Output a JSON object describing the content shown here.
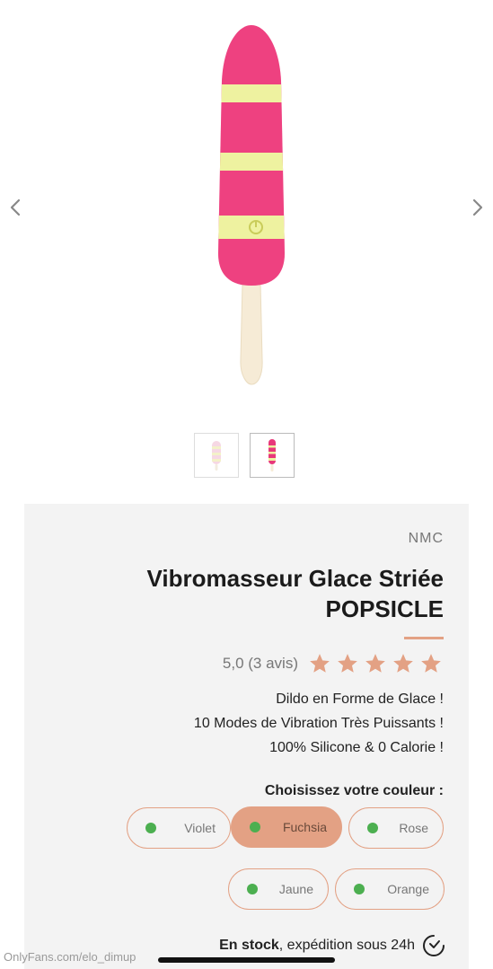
{
  "brand": "NMC",
  "product": {
    "title": "Vibromasseur Glace Striée POPSICLE",
    "rating_text": "5,0 (3 avis)",
    "stars": 5,
    "description": [
      "Dildo en Forme de Glace !",
      "10 Modes de Vibration Très Puissants !",
      "100% Silicone & 0 Calorie !"
    ]
  },
  "color_picker": {
    "label": "Choisissez votre couleur :",
    "options": [
      {
        "label": "Rose",
        "available": true,
        "selected": false
      },
      {
        "label": "Fuchsia",
        "available": true,
        "selected": true
      },
      {
        "label": "Violet",
        "available": true,
        "selected": false
      },
      {
        "label": "Orange",
        "available": true,
        "selected": false
      },
      {
        "label": "Jaune",
        "available": true,
        "selected": false
      }
    ]
  },
  "stock": {
    "status": "En stock",
    "shipping": ", expédition sous 24h"
  },
  "watermark": "OnlyFans.com/elo_dimup",
  "colors": {
    "accent": "#e3a184",
    "pink": "#e8387a",
    "yellow": "#eef2a0",
    "available_dot": "#4caf50"
  }
}
